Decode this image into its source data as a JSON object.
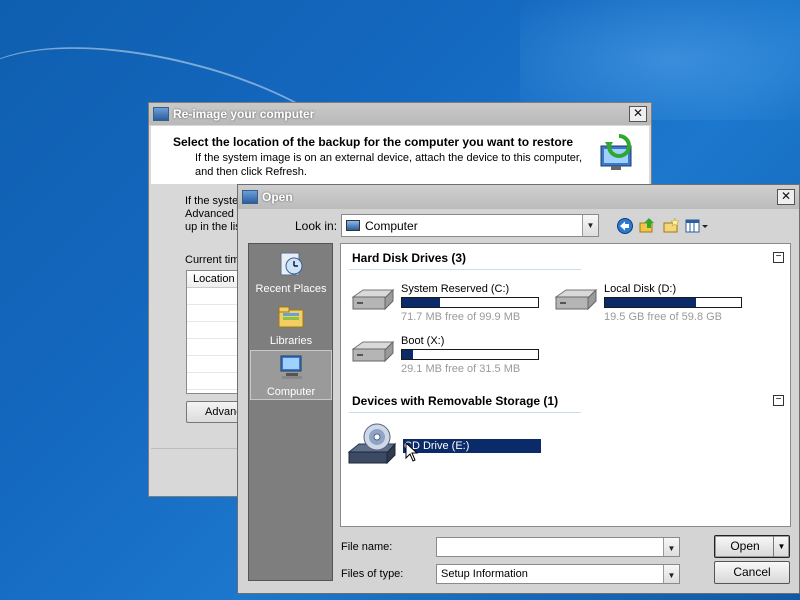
{
  "reimage": {
    "title": "Re-image your computer",
    "header_title": "Select the location of the backup for the computer you want to restore",
    "header_sub": "If the system image is on an external device, attach the device to this computer, and then click Refresh.",
    "body_lines": [
      "If the syste",
      "Advanced",
      "up in the lis"
    ],
    "current_time": "Current tim",
    "table_header": "Location",
    "advanced_button": "Advanc"
  },
  "open": {
    "title": "Open",
    "lookin_label": "Look in:",
    "lookin_value": "Computer",
    "places": [
      {
        "label": "Recent Places"
      },
      {
        "label": "Libraries"
      },
      {
        "label": "Computer",
        "selected": true
      }
    ],
    "groups": [
      {
        "title": "Hard Disk Drives (3)",
        "collapse": "−",
        "drives": [
          {
            "name": "System Reserved (C:)",
            "free": "71.7 MB free of 99.9 MB",
            "used_fraction": 0.28
          },
          {
            "name": "Local Disk (D:)",
            "free": "19.5 GB free of 59.8 GB",
            "used_fraction": 0.67
          },
          {
            "name": "Boot (X:)",
            "free": "29.1 MB free of 31.5 MB",
            "used_fraction": 0.08
          }
        ]
      },
      {
        "title": "Devices with Removable Storage (1)",
        "collapse": "−",
        "drives": [
          {
            "name": "CD Drive (E:)",
            "selected": true
          }
        ]
      }
    ],
    "file_name_label": "File name:",
    "file_name_value": "",
    "file_type_label": "Files of type:",
    "file_type_value": "Setup Information",
    "open_button": "Open",
    "cancel_button": "Cancel"
  },
  "icons": {
    "close": "✕",
    "dropdown": "▼"
  }
}
